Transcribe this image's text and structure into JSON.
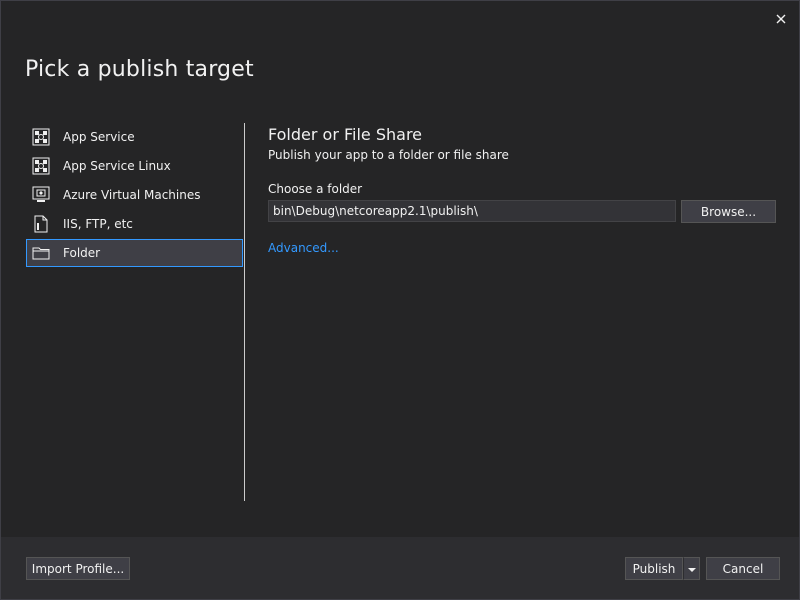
{
  "dialog": {
    "title": "Pick a publish target"
  },
  "sidebar": {
    "items": [
      {
        "label": "App Service",
        "icon": "app-service-icon",
        "selected": false
      },
      {
        "label": "App Service Linux",
        "icon": "app-service-linux-icon",
        "selected": false
      },
      {
        "label": "Azure Virtual Machines",
        "icon": "virtual-machine-icon",
        "selected": false
      },
      {
        "label": "IIS, FTP, etc",
        "icon": "document-icon",
        "selected": false
      },
      {
        "label": "Folder",
        "icon": "folder-icon",
        "selected": true
      }
    ]
  },
  "panel": {
    "title": "Folder or File Share",
    "subtitle": "Publish your app to a folder or file share",
    "choose_label": "Choose a folder",
    "folder_path": "bin\\Debug\\netcoreapp2.1\\publish\\",
    "browse_label": "Browse...",
    "advanced_label": "Advanced..."
  },
  "footer": {
    "import_label": "Import Profile...",
    "publish_label": "Publish",
    "cancel_label": "Cancel"
  },
  "colors": {
    "background": "#252526",
    "footer": "#2d2d30",
    "accent": "#3399ff",
    "text": "#f1f1f1"
  }
}
